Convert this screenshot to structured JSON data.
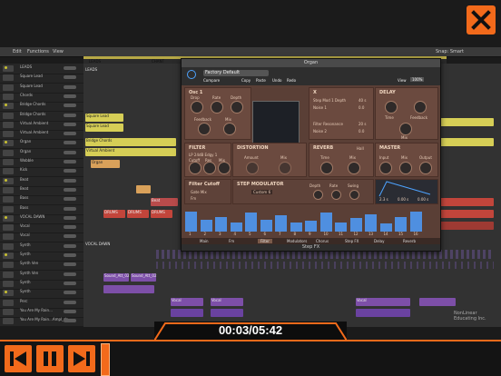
{
  "player": {
    "timecode": "00:03/05:42",
    "close_label": "",
    "accent": "#f26a1b",
    "watermark": "NonLinear Educating Inc."
  },
  "daw": {
    "menu": [
      "Edit",
      "Functions",
      "View"
    ],
    "snap": "Snap: Smart",
    "ruler_markers": [
      "LEADS",
      "CHANT",
      "VOCAL DAWN",
      "SNARE",
      "BEAT"
    ],
    "sections": [
      "LEADS",
      "VOCAL DAWN"
    ],
    "tracks": [
      "LEADS",
      "Square Lead",
      "Square Lead",
      "Chords",
      "Bridge Chords",
      "Bridge Chords",
      "Virtual Ambient",
      "Virtual Ambient",
      "Organ",
      "Organ",
      "Wobble",
      "Kick",
      "Beat",
      "Beat",
      "Bass",
      "Bass",
      "VOCAL DAWN",
      "Vocal",
      "Vocal",
      "Synth",
      "Synth",
      "Synth Ven",
      "Synth Ven",
      "Synth",
      "Synth",
      "Perc",
      "You Are My Rain...",
      "You Are My Rain...Ampl_ds"
    ],
    "region_labels": [
      "Square Lead",
      "Square Lead",
      "Bridge Chords",
      "Virtual Ambient",
      "Organ",
      "DRUMS",
      "DRUMS",
      "DRUMS",
      "Beat",
      "Sound_Att_02",
      "Sound_Att_02",
      "Vocal",
      "Vocal",
      "Vocal"
    ]
  },
  "plugin": {
    "window_title": "Organ",
    "preset": "Factory Default",
    "view_label": "View",
    "zoom": "100%",
    "tabs": [
      "Compare",
      "Copy",
      "Paste",
      "Undo",
      "Redo"
    ],
    "panels": {
      "osc1": {
        "title": "Osc 1",
        "knobs": [
          "Drop",
          "Rate",
          "Depth",
          "Feedback",
          "Mix"
        ]
      },
      "x": {
        "title": "X",
        "rows": [
          "Step Mod 1 Depth",
          "Noise 1",
          "Filter Resonance",
          "Noise 2"
        ],
        "values": [
          "40 s",
          "0.0",
          "20 s",
          "0.0"
        ]
      },
      "delay": {
        "title": "DELAY",
        "knobs": [
          "Time",
          "Feedback",
          "Mix"
        ]
      },
      "filter": {
        "title": "FILTER",
        "mode": "LP 24dB Edgy 1",
        "knobs": [
          "Cutoff",
          "Res",
          "Mix"
        ]
      },
      "distortion": {
        "title": "DISTORTION",
        "knobs": [
          "Amount",
          "Mix"
        ]
      },
      "reverb": {
        "title": "REVERB",
        "mode": "Hall",
        "knobs": [
          "Time",
          "Mix"
        ]
      },
      "master": {
        "title": "MASTER",
        "knobs": [
          "Input",
          "Mix",
          "Output"
        ]
      },
      "filtercutoff": {
        "title": "Filter Cutoff",
        "rows": [
          "Gate Mix",
          "Fm"
        ]
      },
      "stepmod": {
        "title": "STEP MODULATOR",
        "preset": "Custom 6",
        "knobs": [
          "Depth",
          "Rate",
          "Swing"
        ]
      },
      "envelope": {
        "values": [
          "2.3 s",
          "0.00 s",
          "0.00 s"
        ]
      }
    },
    "steps": [
      0.75,
      0.45,
      0.55,
      0.35,
      0.7,
      0.45,
      0.6,
      0.35,
      0.4,
      0.7,
      0.35,
      0.5,
      0.65,
      0.3,
      0.55,
      0.75
    ],
    "step_numbers": [
      "1",
      "2",
      "3",
      "4",
      "5",
      "6",
      "7",
      "8",
      "9",
      "10",
      "11",
      "12",
      "13",
      "14",
      "15",
      "16"
    ],
    "fx_tabs": [
      "Main",
      "Fm",
      "Filter",
      "Modulators",
      "Chorus",
      "Step FX",
      "Delay",
      "Reverb"
    ],
    "footer": "Step FX"
  }
}
